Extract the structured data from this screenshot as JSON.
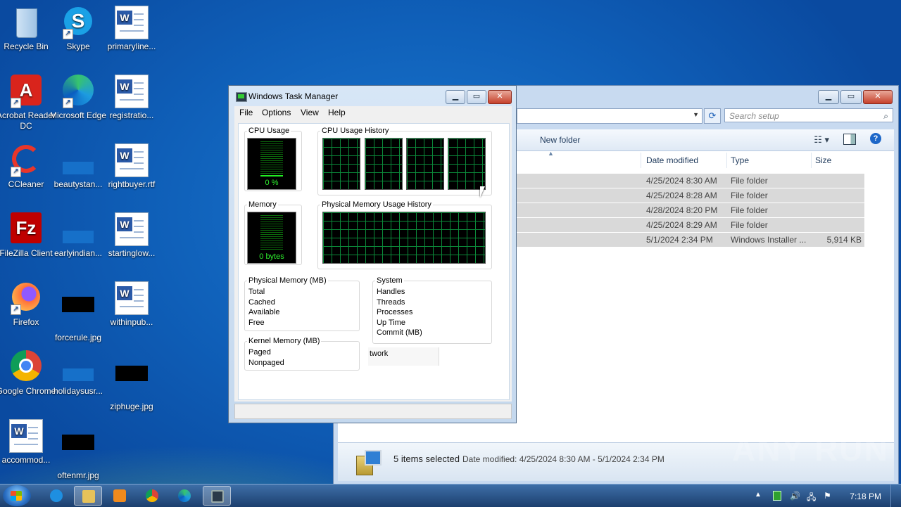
{
  "desktop": {
    "icons": [
      {
        "label": "Recycle Bin"
      },
      {
        "label": "Skype"
      },
      {
        "label": "primaryline..."
      },
      {
        "label": "Acrobat Reader DC"
      },
      {
        "label": "Microsoft Edge"
      },
      {
        "label": "registratio..."
      },
      {
        "label": "CCleaner"
      },
      {
        "label": "beautystan..."
      },
      {
        "label": "rightbuyer.rtf"
      },
      {
        "label": "FileZilla Client"
      },
      {
        "label": "earlyindian..."
      },
      {
        "label": "startinglow..."
      },
      {
        "label": "Firefox"
      },
      {
        "label": "forcerule.jpg"
      },
      {
        "label": "withinpub..."
      },
      {
        "label": "Google Chrome"
      },
      {
        "label": "holidaysusr..."
      },
      {
        "label": "ziphuge.jpg"
      },
      {
        "label": "accommod..."
      },
      {
        "label": "oftenmr.jpg"
      }
    ]
  },
  "explorer": {
    "search_placeholder": "Search setup",
    "toolbar": {
      "new_folder": "New folder"
    },
    "columns": [
      "Date modified",
      "Type",
      "Size"
    ],
    "rows": [
      {
        "date": "4/25/2024 8:30 AM",
        "type": "File folder",
        "size": ""
      },
      {
        "date": "4/25/2024 8:28 AM",
        "type": "File folder",
        "size": ""
      },
      {
        "date": "4/28/2024 8:20 PM",
        "type": "File folder",
        "size": ""
      },
      {
        "date": "4/25/2024 8:29 AM",
        "type": "File folder",
        "size": ""
      },
      {
        "date": "5/1/2024 2:34 PM",
        "type": "Windows Installer ...",
        "size": "5,914 KB"
      }
    ],
    "status": {
      "count": "5 items selected",
      "modified": "Date modified: 4/25/2024 8:30 AM - 5/1/2024 2:34 PM"
    }
  },
  "task_manager": {
    "title": "Windows Task Manager",
    "menu": [
      "File",
      "Options",
      "View",
      "Help"
    ],
    "cpu_usage": {
      "label": "CPU Usage",
      "value": "0 %",
      "fill": 0.0
    },
    "cpu_history": {
      "label": "CPU Usage History"
    },
    "memory": {
      "label": "Memory",
      "value": "0 bytes"
    },
    "mem_history": {
      "label": "Physical Memory Usage History"
    },
    "physical_memory": {
      "label": "Physical Memory (MB)",
      "items": [
        "Total",
        "Cached",
        "Available",
        "Free"
      ]
    },
    "system": {
      "label": "System",
      "items": [
        "Handles",
        "Threads",
        "Processes",
        "Up Time",
        "Commit (MB)"
      ]
    },
    "kernel_memory": {
      "label": "Kernel Memory (MB)",
      "items": [
        "Paged",
        "Nonpaged"
      ]
    },
    "partial_tab": "twork"
  },
  "taskbar": {
    "clock": "7:18 PM"
  },
  "watermark": "ANY RUN"
}
